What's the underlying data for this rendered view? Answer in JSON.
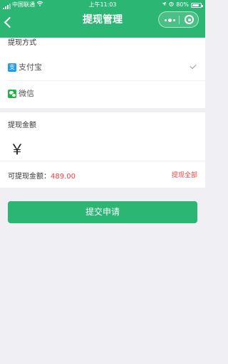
{
  "status_bar": {
    "carrier": "中国联通",
    "time": "上午11:03",
    "battery": "80%",
    "battery_level": 0.8
  },
  "nav": {
    "title": "提现管理",
    "icons": [
      "back-chevron-icon",
      "more-dots-icon",
      "target-icon"
    ]
  },
  "method_section": {
    "label": "提现方式",
    "options": [
      {
        "label": "支付宝",
        "icon": "alipay-icon",
        "selected": true
      },
      {
        "label": "微信",
        "icon": "wechat-icon",
        "selected": false
      }
    ]
  },
  "amount_section": {
    "label": "提现金额",
    "currency_symbol": "￥",
    "available_label": "可提现金额：",
    "available_amount": "489.00",
    "withdraw_all": "提现全部"
  },
  "submit_label": "提交申请",
  "colors": {
    "brand_green": "#2bb673",
    "accent_red": "#e64340",
    "background": "#efeff4"
  }
}
